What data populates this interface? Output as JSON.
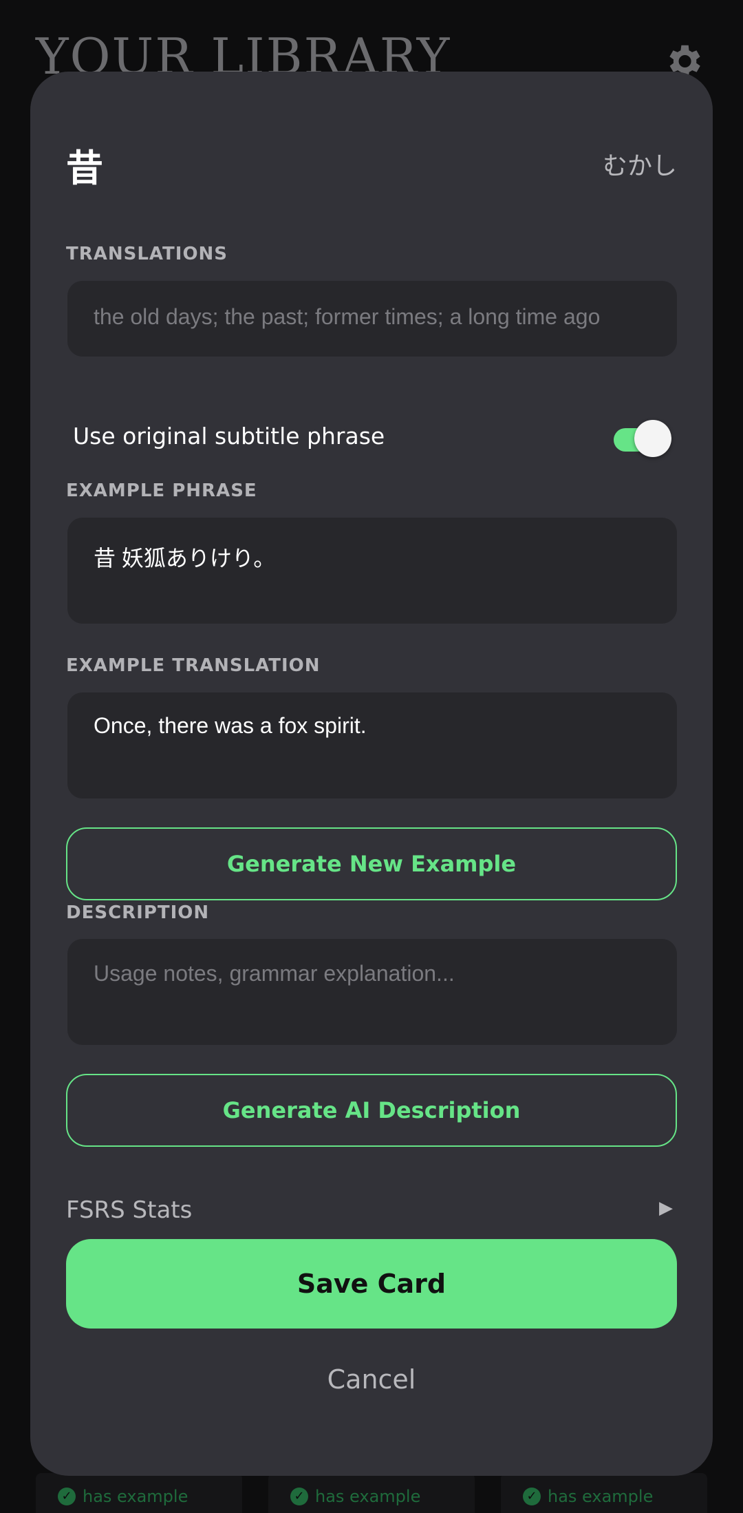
{
  "background": {
    "title": "YOUR LIBRARY",
    "settings_icon": "gear-icon",
    "cards": [
      {
        "badge": "has example"
      },
      {
        "badge": "has example"
      },
      {
        "badge": "has example"
      }
    ]
  },
  "card": {
    "word": "昔",
    "reading": "むかし",
    "translations_label": "TRANSLATIONS",
    "translations_placeholder": "the old days; the past; former times; a long time ago",
    "toggle_label": "Use original subtitle phrase",
    "toggle_on": true,
    "example_phrase_label": "EXAMPLE PHRASE",
    "example_phrase_value": "昔 妖狐ありけり。",
    "example_translation_label": "EXAMPLE TRANSLATION",
    "example_translation_value": "Once, there was a fox spirit.",
    "generate_example_label": "Generate New Example",
    "description_label": "DESCRIPTION",
    "description_placeholder": "Usage notes, grammar explanation...",
    "generate_description_label": "Generate AI Description",
    "fsrs_label": "FSRS Stats",
    "fsrs_icon": "play-arrow-icon",
    "save_label": "Save Card",
    "cancel_label": "Cancel"
  },
  "colors": {
    "accent": "#66e487",
    "modal_bg": "#323238",
    "field_bg": "#27272b",
    "page_bg": "#0d0d0e"
  }
}
